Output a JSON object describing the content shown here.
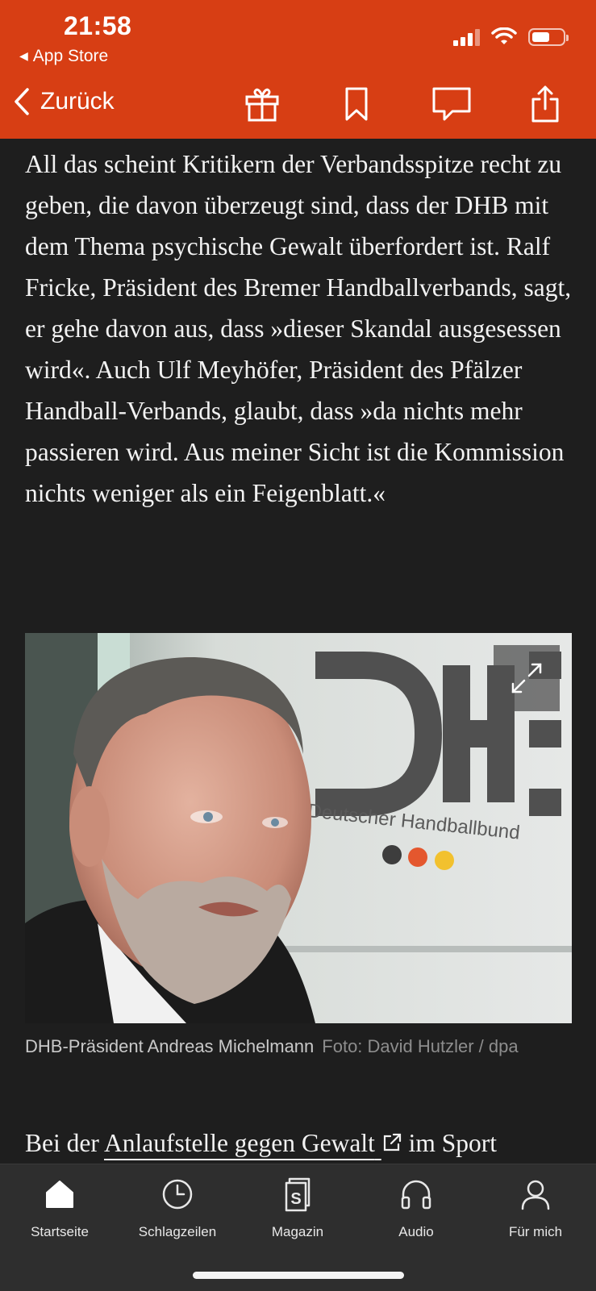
{
  "status_bar": {
    "time": "21:58",
    "back_app": "App Store"
  },
  "nav": {
    "back_label": "Zurück",
    "icons": [
      "gift-icon",
      "bookmark-icon",
      "comment-icon",
      "share-icon"
    ]
  },
  "article": {
    "paragraph": "All das scheint Kritikern der Verbandsspitze recht zu geben, die davon überzeugt sind, dass der DHB mit dem Thema psychische Gewalt überfordert ist. Ralf Fricke, Präsident des Bremer Handballverbands, sagt, er gehe davon aus, dass »dieser Skandal ausgesessen wird«. Auch Ulf Meyhöfer, Präsident des Pfälzer Handball-Verbands, glaubt, dass »da nichts mehr passieren wird. Aus meiner Sicht ist die Kommission nichts weniger als ein Feigenblatt.«",
    "image": {
      "logo_text": "DHB",
      "logo_subtitle": "Deutscher Handballbund",
      "caption": "DHB-Präsident Andreas Michelmann",
      "credit": "Foto: David Hutzler / dpa"
    },
    "next_paragraph": {
      "before": "Bei der ",
      "link": "Anlaufstelle gegen Gewalt",
      "after": " im Sport"
    }
  },
  "tabbar": {
    "tabs": [
      {
        "label": "Startseite",
        "icon": "home-icon"
      },
      {
        "label": "Schlagzeilen",
        "icon": "clock-icon"
      },
      {
        "label": "Magazin",
        "icon": "magazine-icon"
      },
      {
        "label": "Audio",
        "icon": "headphones-icon"
      },
      {
        "label": "Für mich",
        "icon": "person-icon"
      }
    ]
  },
  "colors": {
    "brand": "#d73e14",
    "background": "#1e1e1e",
    "tabbar": "#2e2e2e"
  }
}
